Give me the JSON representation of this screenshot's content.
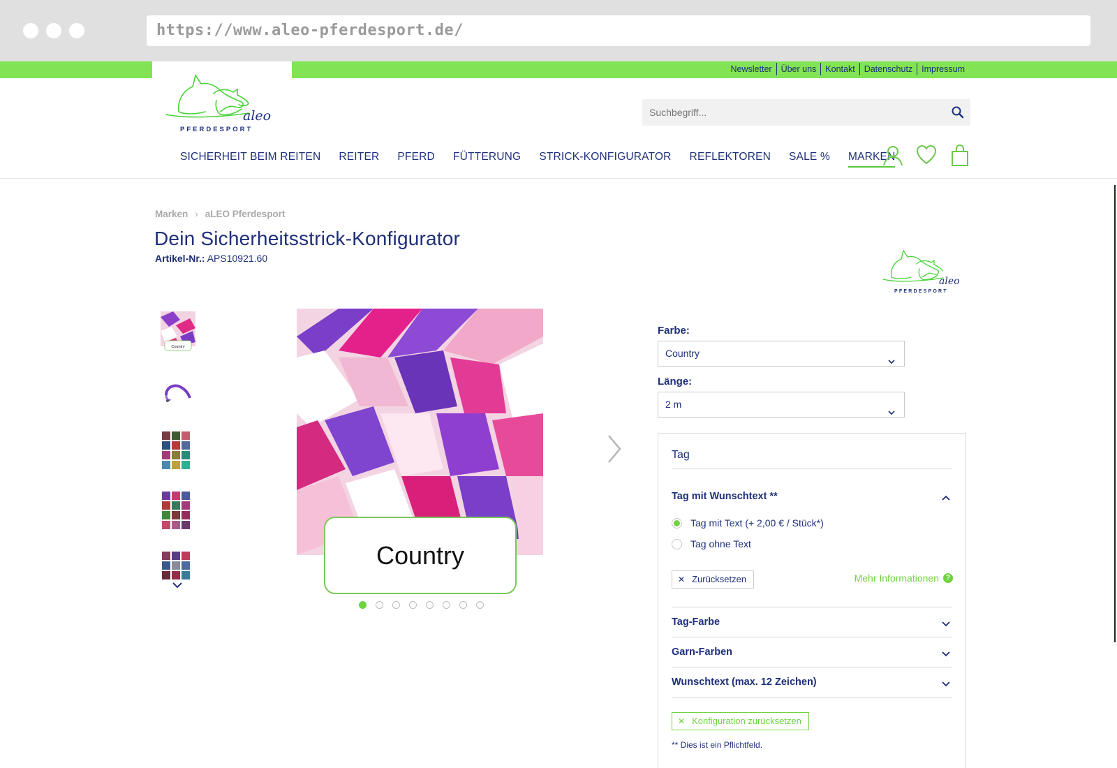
{
  "browser": {
    "url": "https://www.aleo-pferdesport.de/"
  },
  "top_links": [
    "Newsletter",
    "Über uns",
    "Kontakt",
    "Datenschutz",
    "Impressum"
  ],
  "logo": {
    "text": "aleo",
    "sub": "PFERDESPORT"
  },
  "search": {
    "placeholder": "Suchbegriff..."
  },
  "nav": [
    "SICHERHEIT BEIM REITEN",
    "REITER",
    "PFERD",
    "FÜTTERUNG",
    "STRICK-KONFIGURATOR",
    "REFLEKTOREN",
    "SALE %",
    "MARKEN"
  ],
  "breadcrumb": [
    "Marken",
    "aLEO Pferdesport"
  ],
  "product": {
    "title": "Dein Sicherheitsstrick-Konfigurator",
    "article_label": "Artikel-Nr.:",
    "article_number": "APS10921.60",
    "image_label": "Country",
    "thumb_label": "Country"
  },
  "colors": {
    "accent_green": "#82e355",
    "navy": "#1e2f7a"
  },
  "config": {
    "farbe_label": "Farbe:",
    "farbe_value": "Country",
    "laenge_label": "Länge:",
    "laenge_value": "2 m",
    "panel_title": "Tag",
    "tag_section": "Tag mit Wunschtext **",
    "option_1": "Tag mit Text (+ 2,00 € / Stück*)",
    "option_2": "Tag ohne Text",
    "reset": "Zurücksetzen",
    "more_info": "Mehr Informationen",
    "more_info_icon": "?",
    "section_tag_farbe": "Tag-Farbe",
    "section_garn": "Garn-Farben",
    "section_wunschtext": "Wunschtext (max. 12 Zeichen)",
    "reset_all": "Konfiguration zurücksetzen",
    "required_note": "** Dies ist ein Pflichtfeld."
  },
  "gallery": {
    "slides": 8,
    "active": 1
  }
}
